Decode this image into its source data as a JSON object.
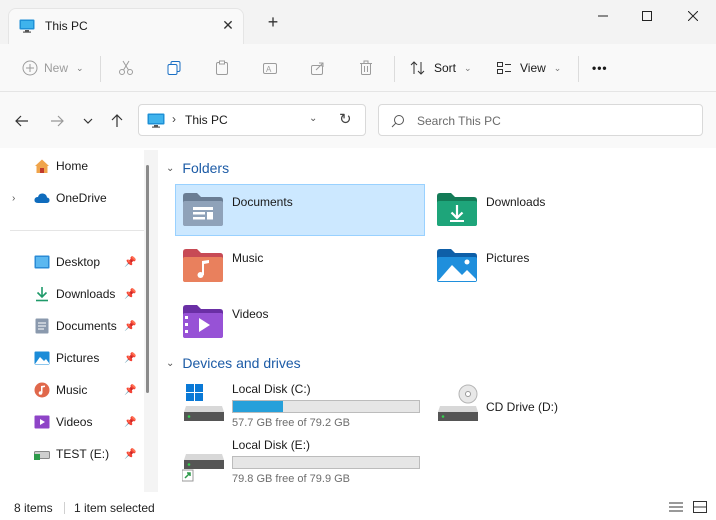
{
  "window": {
    "tab_title": "This PC",
    "tab_close": "✕",
    "new_tab": "+"
  },
  "toolbar": {
    "new_label": "New",
    "sort_label": "Sort",
    "view_label": "View",
    "more_label": "•••"
  },
  "address": {
    "crumb": "This PC",
    "search_placeholder": "Search This PC"
  },
  "sidebar": {
    "items": [
      {
        "label": "Home"
      },
      {
        "label": "OneDrive"
      },
      {
        "label": "Desktop"
      },
      {
        "label": "Downloads"
      },
      {
        "label": "Documents"
      },
      {
        "label": "Pictures"
      },
      {
        "label": "Music"
      },
      {
        "label": "Videos"
      },
      {
        "label": "TEST (E:)"
      }
    ]
  },
  "content": {
    "folders_heading": "Folders",
    "folders": [
      {
        "name": "Documents"
      },
      {
        "name": "Downloads"
      },
      {
        "name": "Music"
      },
      {
        "name": "Pictures"
      },
      {
        "name": "Videos"
      }
    ],
    "drives_heading": "Devices and drives",
    "drives": [
      {
        "name": "Local Disk (C:)",
        "free": "57.7 GB free of 79.2 GB",
        "used_fraction": 0.27
      },
      {
        "name": "CD Drive (D:)"
      },
      {
        "name": "Local Disk (E:)",
        "free": "79.8 GB free of 79.9 GB",
        "used_fraction": 0.0
      }
    ]
  },
  "status": {
    "items_count": "8 items",
    "selection": "1 item selected"
  },
  "colors": {
    "accent": "#1c5ba6",
    "selection": "#cce8ff",
    "drive_fill": "#26a0da"
  }
}
